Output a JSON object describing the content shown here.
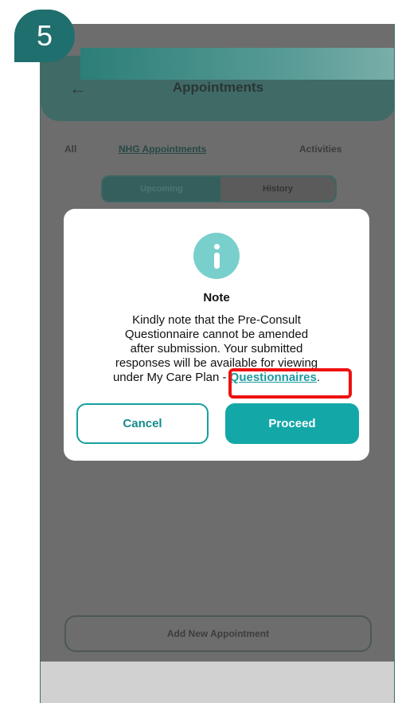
{
  "step_badge": "5",
  "app": {
    "title": "Appointments",
    "back_label": "←"
  },
  "tabs": [
    {
      "label": "All"
    },
    {
      "label": "NHG Appointments"
    },
    {
      "label": "Activities"
    }
  ],
  "segment": {
    "upcoming_label": "Upcoming",
    "history_label": "History"
  },
  "dialog": {
    "title": "Note",
    "body_line1": "Kindly note that the Pre-Consult",
    "body_line2": "Questionnaire cannot be amended",
    "body_line3": "after submission. Your submitted",
    "body_line4": "responses will be available for viewing",
    "body_prefix": "under My Care Plan - ",
    "link_text": "Questionnaires",
    "body_suffix": ".",
    "cancel_label": "Cancel",
    "proceed_label": "Proceed"
  },
  "bottom": {
    "add_appointment_label": "Add New Appointment"
  },
  "colors": {
    "accent": "#14a7a8",
    "highlight": "#ef1010",
    "badge": "#1f6f6e"
  }
}
